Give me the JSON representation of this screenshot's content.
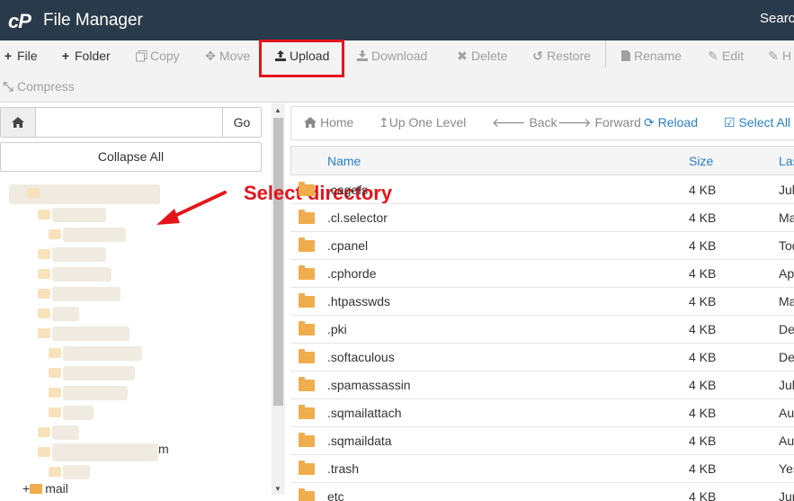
{
  "app": {
    "logo": "cP",
    "title": "File Manager",
    "search_label": "Search"
  },
  "toolbar": {
    "file": "File",
    "folder": "Folder",
    "copy": "Copy",
    "move": "Move",
    "upload": "Upload",
    "download": "Download",
    "delete": "Delete",
    "restore": "Restore",
    "rename": "Rename",
    "edit": "Edit",
    "html_editor": "H",
    "compress": "Compress"
  },
  "left": {
    "go": "Go",
    "path_value": "",
    "collapse_all": "Collapse All",
    "tree_partial_1": "m",
    "tree_mail": "mail"
  },
  "annotation": "Select directory",
  "nav": {
    "home": "Home",
    "up": "Up One Level",
    "back": "Back",
    "forward": "Forward",
    "reload": "Reload",
    "select_all": "Select All"
  },
  "table": {
    "headers": {
      "name": "Name",
      "size": "Size",
      "last": "Las"
    },
    "rows": [
      {
        "name": ".cagefs",
        "size": "4 KB",
        "date": "Jul"
      },
      {
        "name": ".cl.selector",
        "size": "4 KB",
        "date": "Ma"
      },
      {
        "name": ".cpanel",
        "size": "4 KB",
        "date": "Tod"
      },
      {
        "name": ".cphorde",
        "size": "4 KB",
        "date": "Ap"
      },
      {
        "name": ".htpasswds",
        "size": "4 KB",
        "date": "Ma"
      },
      {
        "name": ".pki",
        "size": "4 KB",
        "date": "De"
      },
      {
        "name": ".softaculous",
        "size": "4 KB",
        "date": "De"
      },
      {
        "name": ".spamassassin",
        "size": "4 KB",
        "date": "Jul"
      },
      {
        "name": ".sqmailattach",
        "size": "4 KB",
        "date": "Au"
      },
      {
        "name": ".sqmaildata",
        "size": "4 KB",
        "date": "Au"
      },
      {
        "name": ".trash",
        "size": "4 KB",
        "date": "Yes"
      },
      {
        "name": "etc",
        "size": "4 KB",
        "date": "Jun"
      }
    ]
  },
  "colors": {
    "topbar": "#293a4a",
    "accent": "#2a7fc4",
    "highlight": "#e4141b",
    "folder": "#f0ad4e"
  }
}
